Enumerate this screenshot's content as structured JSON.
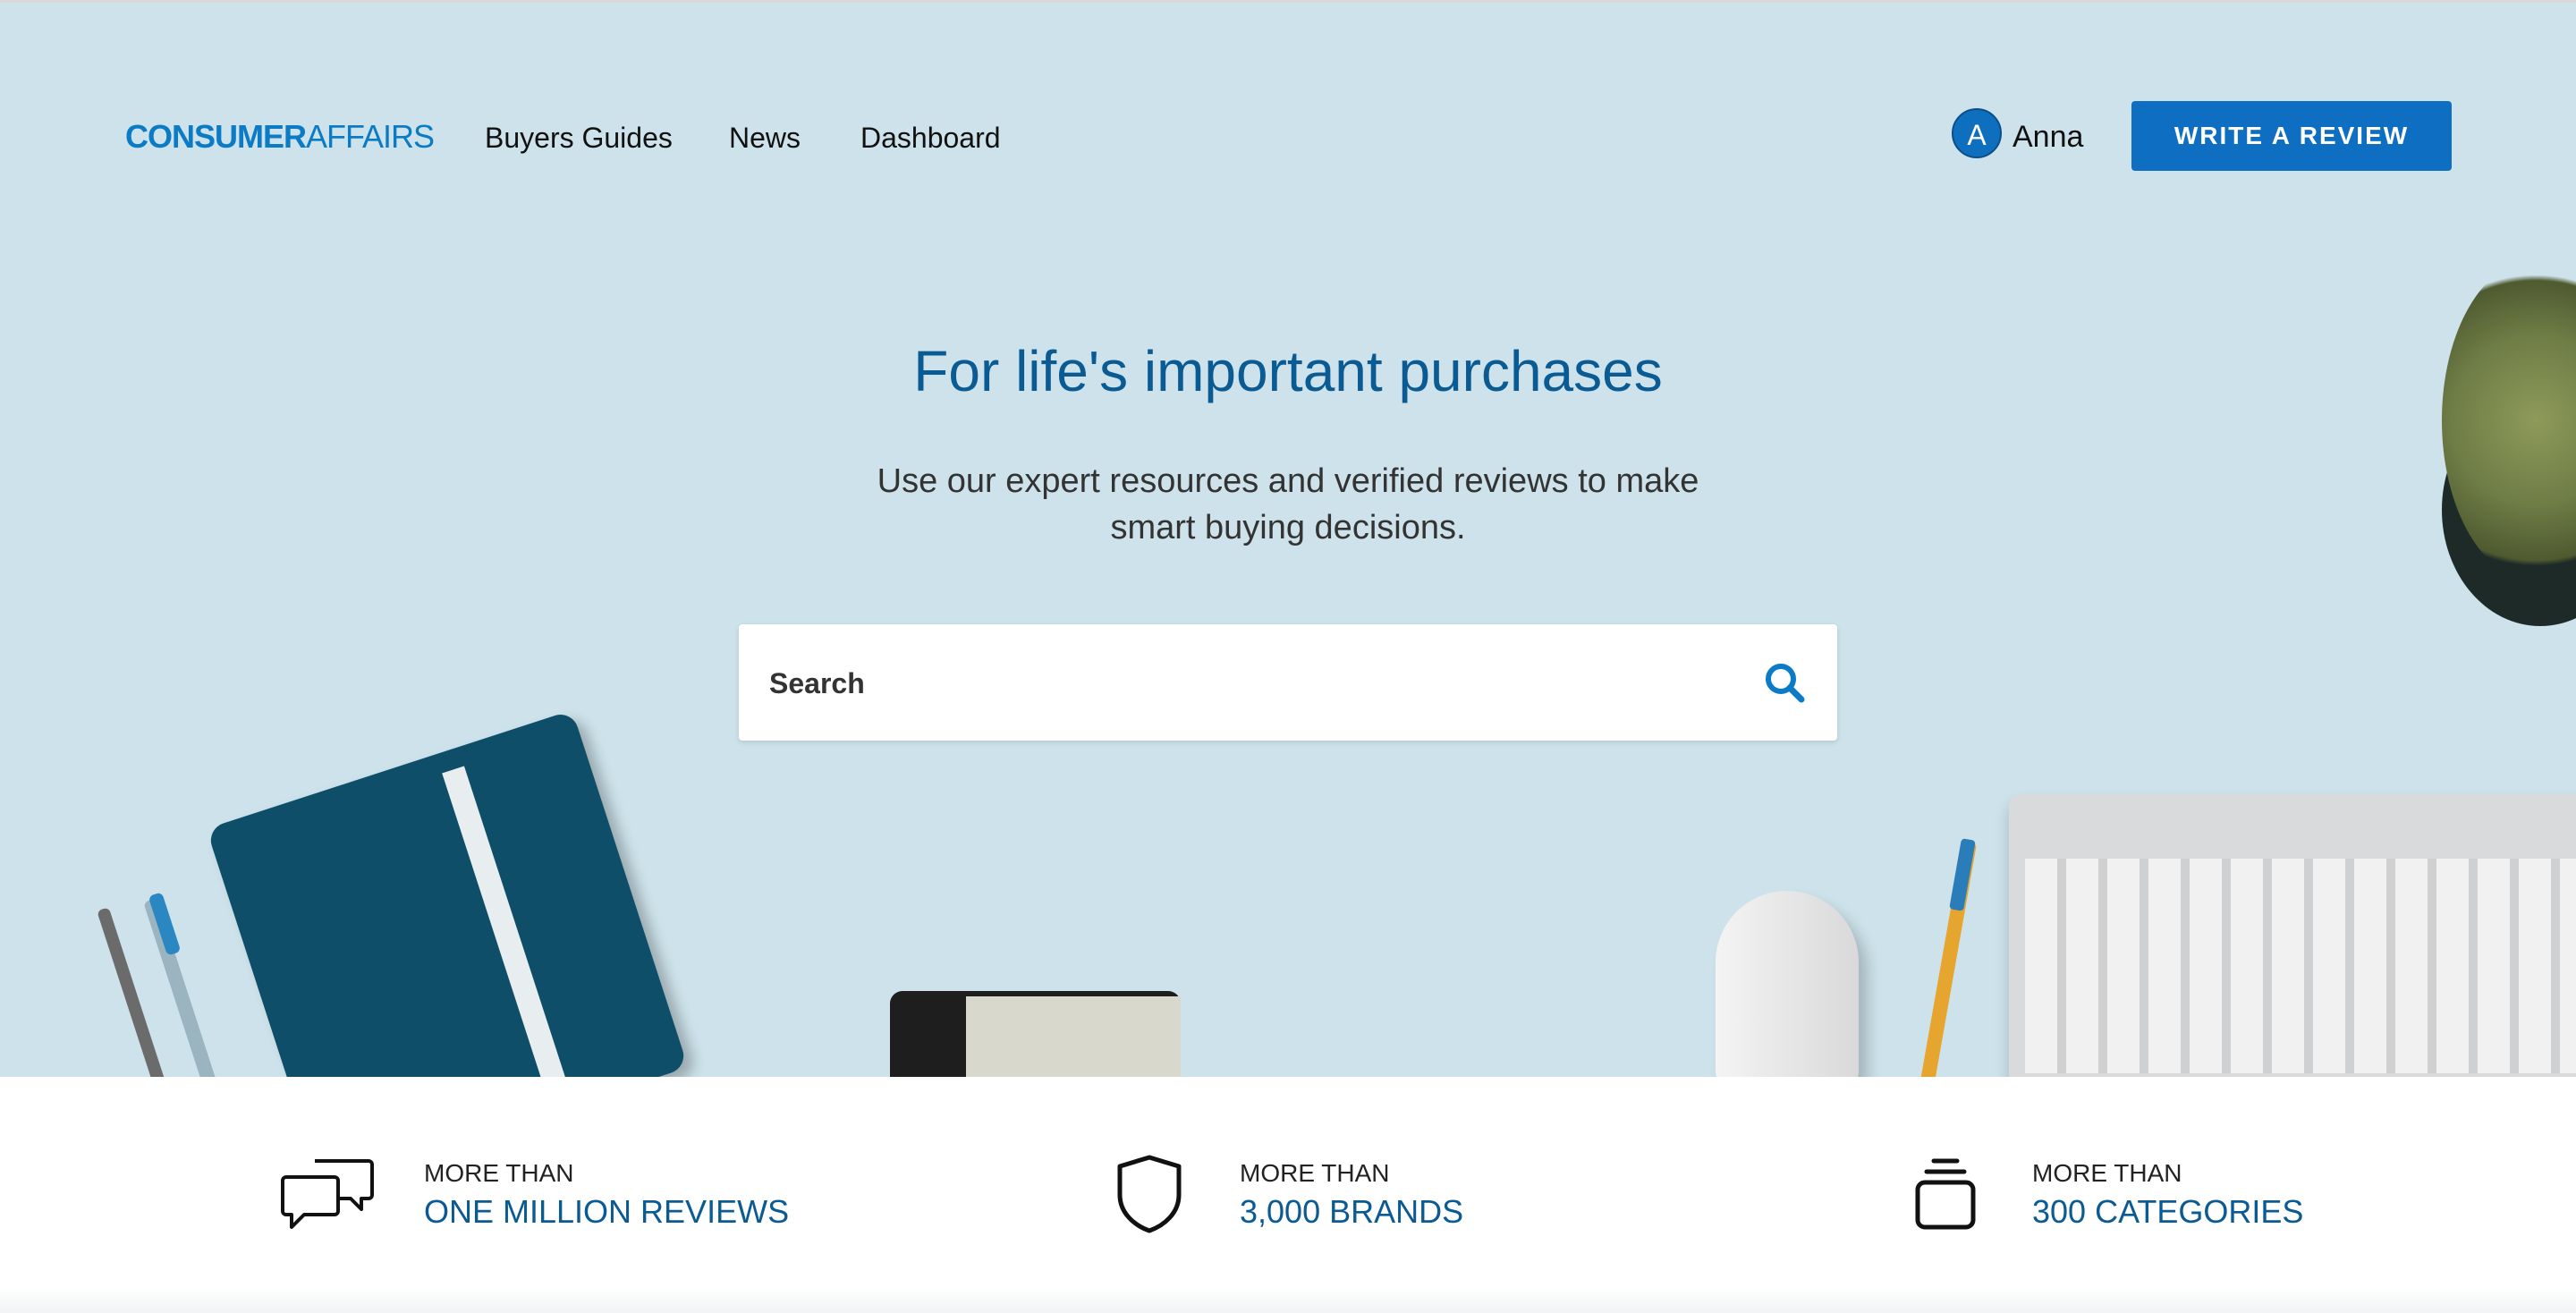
{
  "header": {
    "logo_bold": "CONSUMER",
    "logo_light": "AFFAIRS",
    "nav": [
      "Buyers Guides",
      "News",
      "Dashboard"
    ],
    "user": {
      "initial": "A",
      "name": "Anna"
    },
    "cta_label": "WRITE A REVIEW"
  },
  "hero": {
    "headline": "For life's important purchases",
    "subline": "Use our expert resources and verified reviews to make smart buying decisions.",
    "search_placeholder": "Search"
  },
  "stats": [
    {
      "icon": "chat-bubbles-icon",
      "label": "MORE THAN",
      "value": "ONE MILLION REVIEWS"
    },
    {
      "icon": "shield-icon",
      "label": "MORE THAN",
      "value": "3,000 BRANDS"
    },
    {
      "icon": "stack-icon",
      "label": "MORE THAN",
      "value": "300 CATEGORIES"
    }
  ],
  "colors": {
    "brand_blue": "#0a7bc4",
    "cta_blue": "#0e6fc2",
    "headline_blue": "#0a5a93",
    "hero_bg": "#cde2ea"
  }
}
